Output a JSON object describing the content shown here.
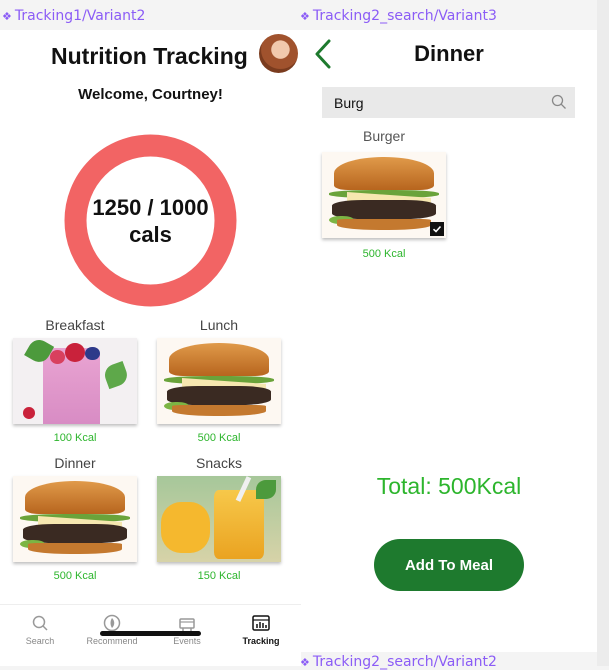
{
  "frames": {
    "left_label": "Tracking1/Variant2",
    "right_label": "Tracking2_search/Variant3",
    "bottom_label": "Tracking2_search/Variant2"
  },
  "tracking": {
    "title": "Nutrition Tracking",
    "welcome": "Welcome, Courtney!",
    "ring": {
      "value_line": "1250 / 1000",
      "unit": "cals",
      "color": "#f26464",
      "progress": 1.0
    },
    "meals": [
      {
        "label": "Breakfast",
        "kcal": "100 Kcal",
        "image": "smoothie"
      },
      {
        "label": "Lunch",
        "kcal": "500 Kcal",
        "image": "burger"
      },
      {
        "label": "Dinner",
        "kcal": "500 Kcal",
        "image": "burger"
      },
      {
        "label": "Snacks",
        "kcal": "150 Kcal",
        "image": "mango-juice"
      }
    ],
    "tabs": [
      {
        "label": "Search",
        "icon": "search-icon"
      },
      {
        "label": "Recommend",
        "icon": "recommend-icon"
      },
      {
        "label": "Events",
        "icon": "events-icon"
      },
      {
        "label": "Tracking",
        "icon": "tracking-icon",
        "active": true
      }
    ]
  },
  "search_page": {
    "title": "Dinner",
    "search_value": "Burg",
    "results": [
      {
        "label": "Burger",
        "kcal": "500 Kcal",
        "selected": true
      }
    ],
    "total": "Total: 500Kcal",
    "add_button": "Add To Meal",
    "button_color": "#1e7a2e",
    "accent_green": "#2db52d"
  }
}
